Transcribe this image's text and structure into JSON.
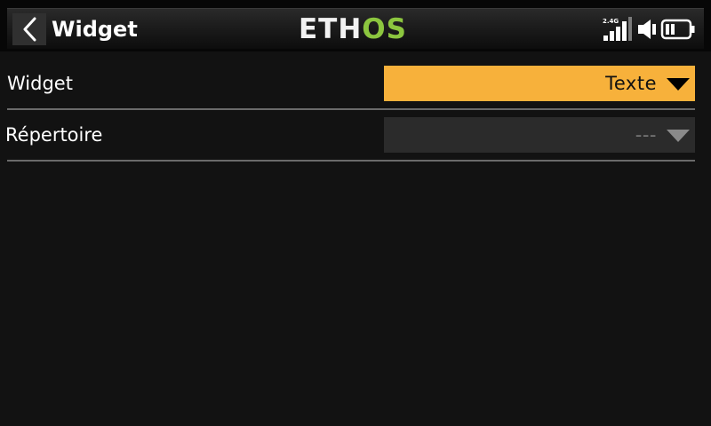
{
  "header": {
    "title": "Widget",
    "back_icon": "chevron-left-icon",
    "logo": {
      "part1": "ETH",
      "part2": "OS",
      "part1_color": "#f2f2f2",
      "part2_color": "#8cc63f"
    },
    "status": {
      "rf_band": "2.4G",
      "signal_bars": 4,
      "signal_icon": "signal-bars-icon",
      "volume_icon": "speaker-icon",
      "battery_icon": "battery-icon",
      "battery_level_fraction": 0.5
    }
  },
  "settings": [
    {
      "label": "Widget",
      "value": "Texte",
      "state": "active",
      "accent": "#f7b13b"
    },
    {
      "label": "Répertoire",
      "value": "---",
      "state": "disabled"
    }
  ],
  "colors": {
    "background": "#121212",
    "accent": "#f7b13b",
    "divider": "#6a6a6a"
  }
}
